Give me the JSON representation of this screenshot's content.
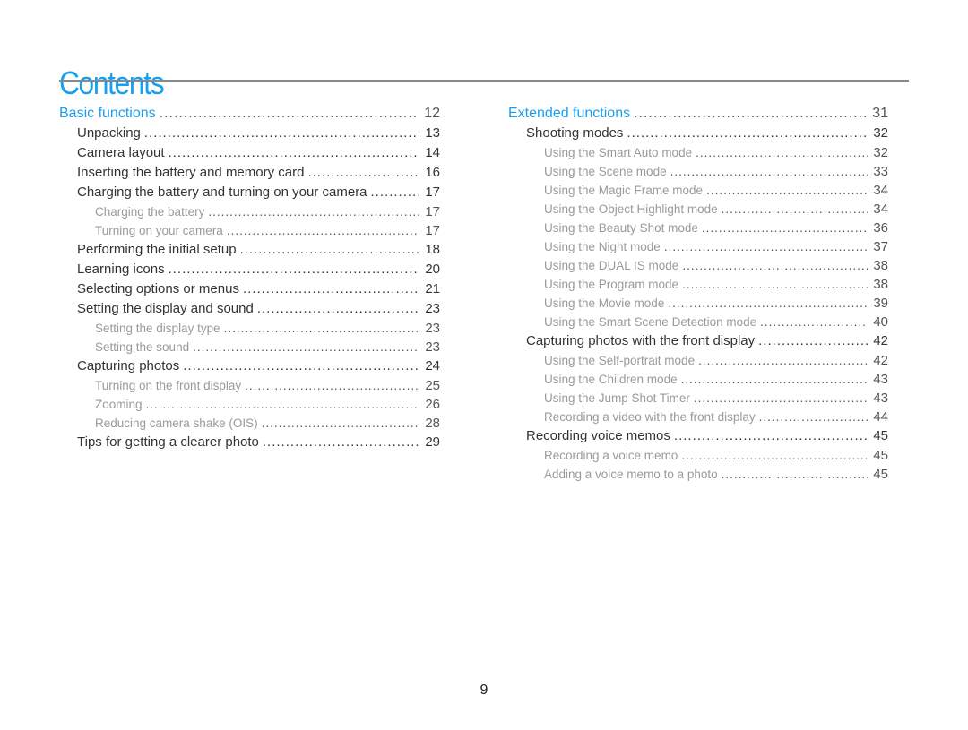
{
  "title": "Contents",
  "page_number": "9",
  "left_column": [
    {
      "level": 1,
      "label": "Basic functions",
      "page": "12"
    },
    {
      "level": 2,
      "label": "Unpacking",
      "page": "13"
    },
    {
      "level": 2,
      "label": "Camera layout",
      "page": "14"
    },
    {
      "level": 2,
      "label": "Inserting the battery and memory card",
      "page": "16"
    },
    {
      "level": 2,
      "label": "Charging the battery and turning on your camera",
      "page": "17"
    },
    {
      "level": 3,
      "label": "Charging the battery",
      "page": "17"
    },
    {
      "level": 3,
      "label": "Turning on your camera",
      "page": "17"
    },
    {
      "level": 2,
      "label": "Performing the initial setup",
      "page": "18"
    },
    {
      "level": 2,
      "label": "Learning icons",
      "page": "20"
    },
    {
      "level": 2,
      "label": "Selecting options or menus",
      "page": "21"
    },
    {
      "level": 2,
      "label": "Setting the display and sound",
      "page": "23"
    },
    {
      "level": 3,
      "label": "Setting the display type",
      "page": "23"
    },
    {
      "level": 3,
      "label": "Setting the sound",
      "page": "23"
    },
    {
      "level": 2,
      "label": "Capturing photos",
      "page": "24"
    },
    {
      "level": 3,
      "label": "Turning on the front display",
      "page": "25"
    },
    {
      "level": 3,
      "label": "Zooming",
      "page": "26"
    },
    {
      "level": 3,
      "label": "Reducing camera shake (OIS)",
      "page": "28"
    },
    {
      "level": 2,
      "label": "Tips for getting a clearer photo",
      "page": "29"
    }
  ],
  "right_column": [
    {
      "level": 1,
      "label": "Extended functions",
      "page": "31"
    },
    {
      "level": 2,
      "label": "Shooting modes",
      "page": "32"
    },
    {
      "level": 3,
      "label": "Using the Smart Auto mode",
      "page": "32"
    },
    {
      "level": 3,
      "label": "Using the Scene mode",
      "page": "33"
    },
    {
      "level": 3,
      "label": "Using the Magic Frame mode",
      "page": "34"
    },
    {
      "level": 3,
      "label": "Using the Object Highlight mode",
      "page": "34"
    },
    {
      "level": 3,
      "label": "Using the Beauty Shot mode",
      "page": "36"
    },
    {
      "level": 3,
      "label": "Using the Night mode",
      "page": "37"
    },
    {
      "level": 3,
      "label": "Using the DUAL IS mode",
      "page": "38"
    },
    {
      "level": 3,
      "label": "Using the Program mode",
      "page": "38"
    },
    {
      "level": 3,
      "label": "Using the Movie mode",
      "page": "39"
    },
    {
      "level": 3,
      "label": "Using the Smart Scene Detection mode",
      "page": "40"
    },
    {
      "level": 2,
      "label": "Capturing photos with the front display",
      "page": "42"
    },
    {
      "level": 3,
      "label": "Using the Self-portrait mode",
      "page": "42"
    },
    {
      "level": 3,
      "label": "Using the Children mode",
      "page": "43"
    },
    {
      "level": 3,
      "label": "Using the Jump Shot Timer",
      "page": "43"
    },
    {
      "level": 3,
      "label": "Recording a video with the front display",
      "page": "44"
    },
    {
      "level": 2,
      "label": "Recording voice memos",
      "page": "45"
    },
    {
      "level": 3,
      "label": "Recording a voice memo",
      "page": "45"
    },
    {
      "level": 3,
      "label": "Adding a voice memo to a photo",
      "page": "45"
    }
  ],
  "colors": {
    "accent": "#1a9ff0",
    "text": "#333333",
    "subtext": "#9a9a9a",
    "rule": "#8a8a8a"
  }
}
